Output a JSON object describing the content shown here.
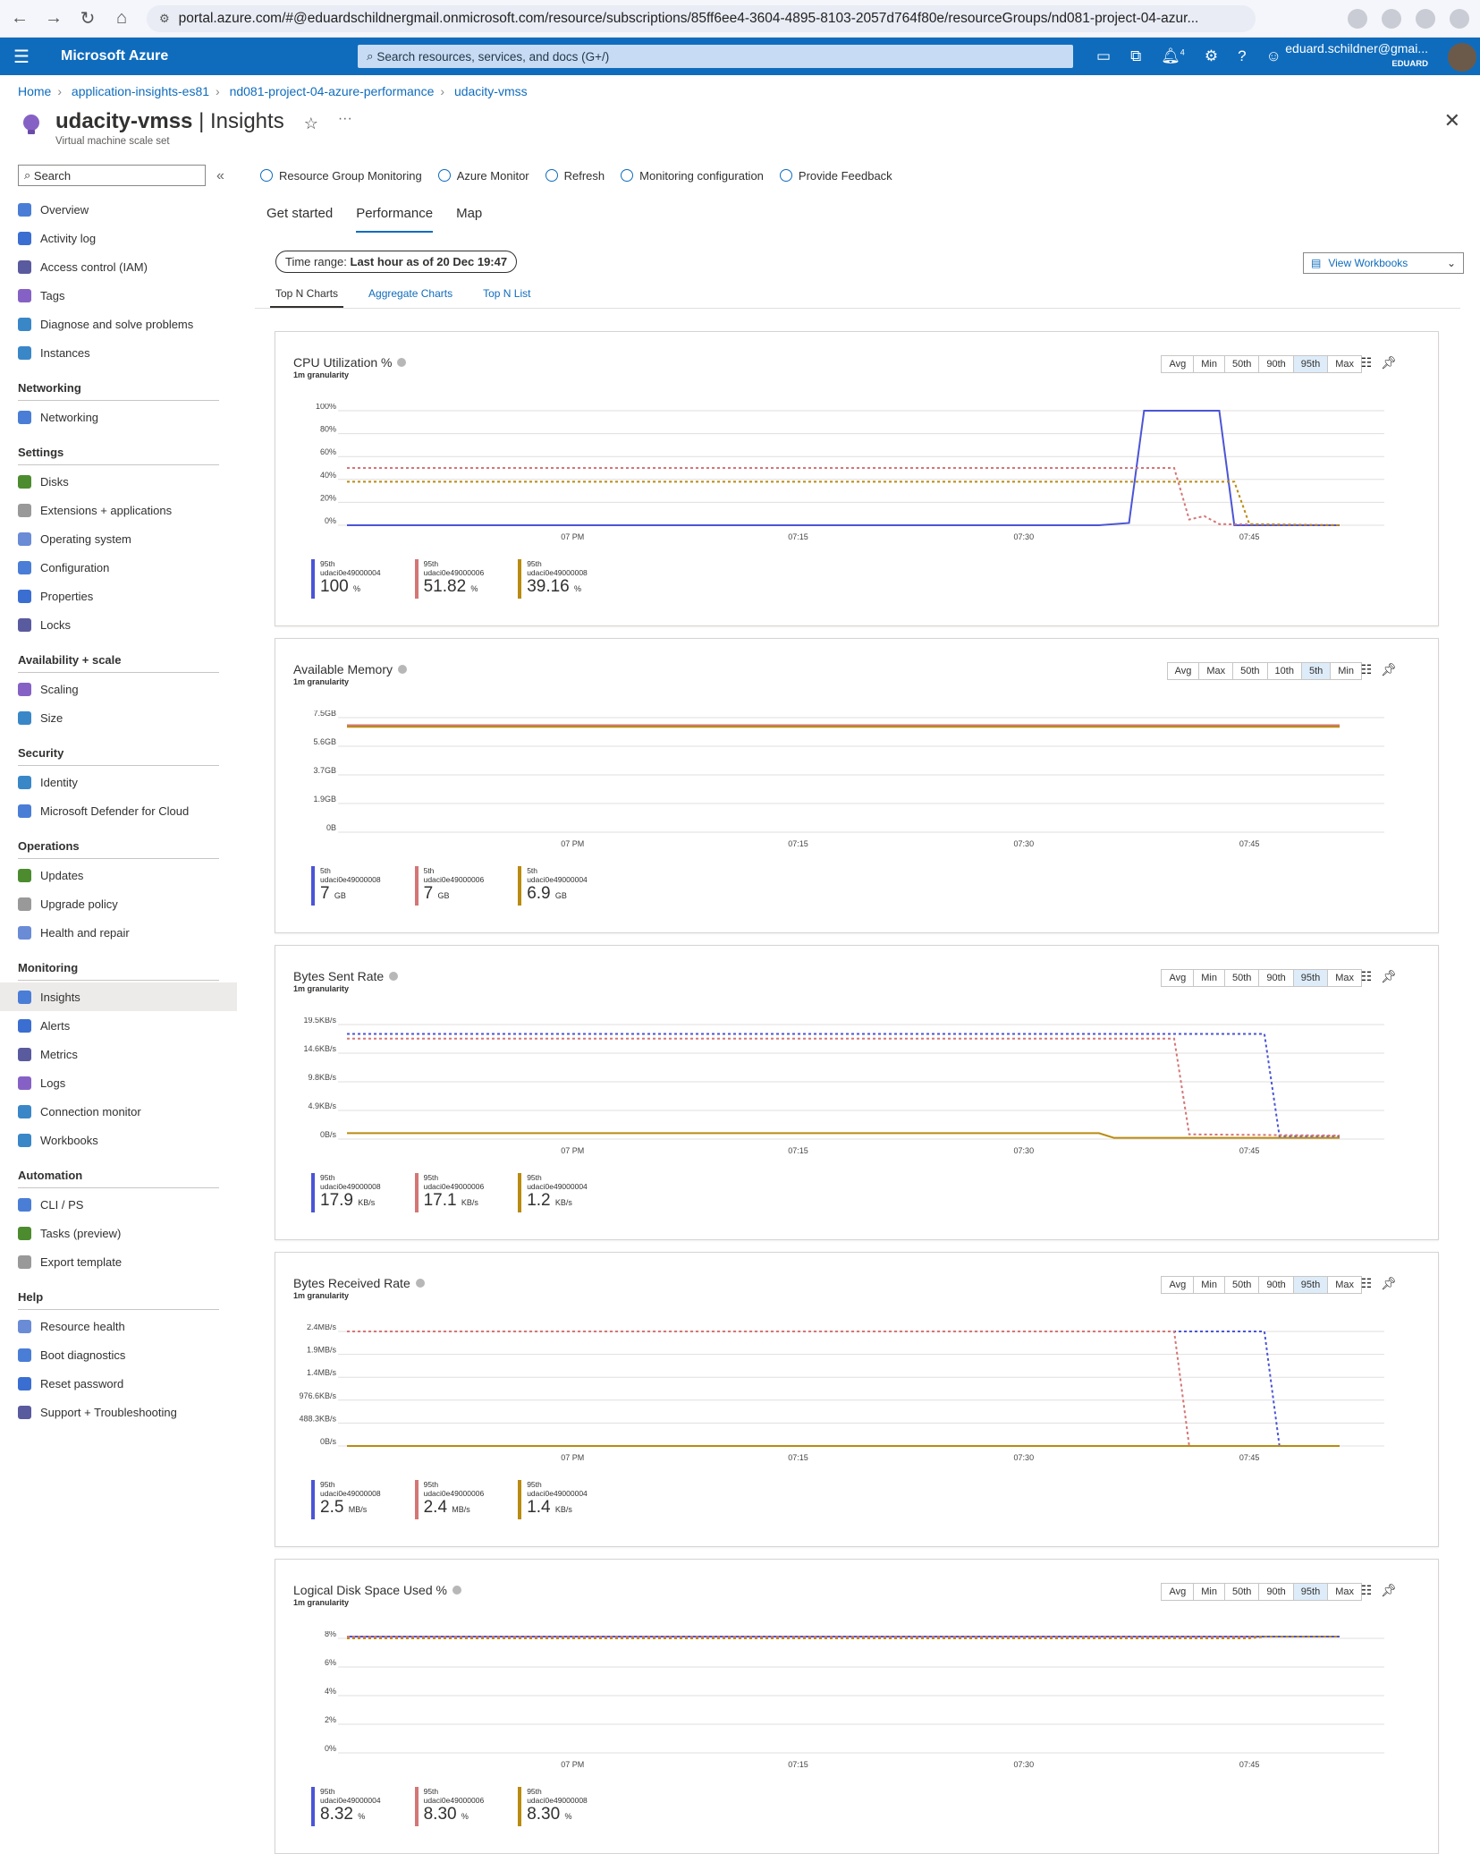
{
  "browser": {
    "url": "portal.azure.com/#@eduardschildnergmail.onmicrosoft.com/resource/subscriptions/85ff6ee4-3604-4895-8103-2057d764f80e/resourceGroups/nd081-project-04-azur..."
  },
  "topbar": {
    "brand": "Microsoft Azure",
    "search_placeholder": "Search resources, services, and docs (G+/)",
    "notifications": "4",
    "user": "eduard.schildner@gmai...",
    "tenant": "EDUARD"
  },
  "breadcrumb": [
    "Home",
    "application-insights-es81",
    "nd081-project-04-azure-performance",
    "udacity-vmss"
  ],
  "title": {
    "resource": "udacity-vmss",
    "page": "Insights",
    "subtitle": "Virtual machine scale set"
  },
  "sidebar": {
    "search": "Search",
    "top": [
      "Overview",
      "Activity log",
      "Access control (IAM)",
      "Tags",
      "Diagnose and solve problems",
      "Instances"
    ],
    "sections": [
      {
        "title": "Networking",
        "items": [
          "Networking"
        ]
      },
      {
        "title": "Settings",
        "items": [
          "Disks",
          "Extensions + applications",
          "Operating system",
          "Configuration",
          "Properties",
          "Locks"
        ]
      },
      {
        "title": "Availability + scale",
        "items": [
          "Scaling",
          "Size"
        ]
      },
      {
        "title": "Security",
        "items": [
          "Identity",
          "Microsoft Defender for Cloud"
        ]
      },
      {
        "title": "Operations",
        "items": [
          "Updates",
          "Upgrade policy",
          "Health and repair"
        ]
      },
      {
        "title": "Monitoring",
        "items": [
          "Insights",
          "Alerts",
          "Metrics",
          "Logs",
          "Connection monitor",
          "Workbooks"
        ]
      },
      {
        "title": "Automation",
        "items": [
          "CLI / PS",
          "Tasks (preview)",
          "Export template"
        ]
      },
      {
        "title": "Help",
        "items": [
          "Resource health",
          "Boot diagnostics",
          "Reset password",
          "Support + Troubleshooting"
        ]
      }
    ],
    "active": "Insights"
  },
  "commands": [
    "Resource Group Monitoring",
    "Azure Monitor",
    "Refresh",
    "Monitoring configuration",
    "Provide Feedback"
  ],
  "tabs": [
    "Get started",
    "Performance",
    "Map"
  ],
  "active_tab": "Performance",
  "time_range": {
    "label": "Time range:",
    "value": "Last hour as of 20 Dec 19:47"
  },
  "view_workbooks": "View Workbooks",
  "subtabs": [
    "Top N Charts",
    "Aggregate Charts",
    "Top N List"
  ],
  "colors": {
    "blue": "#4b55d6",
    "red": "#d47676",
    "gold": "#b98b10",
    "accent": "#0f6cbd"
  },
  "chart_data": [
    {
      "type": "line",
      "title": "CPU Utilization %",
      "granularity": "1m granularity",
      "aggregations": [
        "Avg",
        "Min",
        "50th",
        "90th",
        "95th",
        "Max"
      ],
      "selected": "95th",
      "yticks": [
        "100%",
        "80%",
        "60%",
        "40%",
        "20%",
        "0%"
      ],
      "ylim": [
        0,
        100
      ],
      "xticks": [
        "07 PM",
        "07:15",
        "07:30",
        "07:45"
      ],
      "series": [
        {
          "color": "#4b55d6",
          "points": [
            [
              0,
              0
            ],
            [
              50,
              0
            ],
            [
              52,
              2
            ],
            [
              53,
              100
            ],
            [
              58,
              100
            ],
            [
              59,
              0
            ],
            [
              66,
              0
            ]
          ],
          "dashed_level": null
        },
        {
          "color": "#d47676",
          "points": [
            [
              0,
              50
            ],
            [
              55,
              50
            ],
            [
              56,
              5
            ],
            [
              57,
              8
            ],
            [
              58,
              1
            ],
            [
              66,
              0
            ]
          ],
          "dashed": true
        },
        {
          "color": "#b98b10",
          "points": [
            [
              0,
              38
            ],
            [
              59,
              38
            ],
            [
              60,
              1
            ],
            [
              66,
              0
            ]
          ],
          "dashed": true
        }
      ],
      "legend": [
        {
          "stat": "95th",
          "name": "udaci0e49000004",
          "value": "100",
          "unit": "%",
          "color": "#4b55d6"
        },
        {
          "stat": "95th",
          "name": "udaci0e49000006",
          "value": "51.82",
          "unit": "%",
          "color": "#d47676"
        },
        {
          "stat": "95th",
          "name": "udaci0e49000008",
          "value": "39.16",
          "unit": "%",
          "color": "#b98b10"
        }
      ]
    },
    {
      "type": "line",
      "title": "Available Memory",
      "granularity": "1m granularity",
      "aggregations": [
        "Avg",
        "Max",
        "50th",
        "10th",
        "5th",
        "Min"
      ],
      "selected": "5th",
      "yticks": [
        "7.5GB",
        "5.6GB",
        "3.7GB",
        "1.9GB",
        "0B"
      ],
      "ylim": [
        0,
        7.5
      ],
      "xticks": [
        "07 PM",
        "07:15",
        "07:30",
        "07:45"
      ],
      "series": [
        {
          "color": "#4b55d6",
          "points": [
            [
              0,
              7
            ],
            [
              66,
              7
            ]
          ]
        },
        {
          "color": "#d47676",
          "points": [
            [
              0,
              7
            ],
            [
              66,
              7
            ]
          ]
        },
        {
          "color": "#b98b10",
          "points": [
            [
              0,
              6.9
            ],
            [
              66,
              6.9
            ]
          ]
        }
      ],
      "legend": [
        {
          "stat": "5th",
          "name": "udaci0e49000008",
          "value": "7",
          "unit": "GB",
          "color": "#4b55d6"
        },
        {
          "stat": "5th",
          "name": "udaci0e49000006",
          "value": "7",
          "unit": "GB",
          "color": "#d47676"
        },
        {
          "stat": "5th",
          "name": "udaci0e49000004",
          "value": "6.9",
          "unit": "GB",
          "color": "#b98b10"
        }
      ]
    },
    {
      "type": "line",
      "title": "Bytes Sent Rate",
      "granularity": "1m granularity",
      "aggregations": [
        "Avg",
        "Min",
        "50th",
        "90th",
        "95th",
        "Max"
      ],
      "selected": "95th",
      "yticks": [
        "19.5KB/s",
        "14.6KB/s",
        "9.8KB/s",
        "4.9KB/s",
        "0B/s"
      ],
      "ylim": [
        0,
        19.5
      ],
      "xticks": [
        "07 PM",
        "07:15",
        "07:30",
        "07:45"
      ],
      "series": [
        {
          "color": "#4b55d6",
          "points": [
            [
              0,
              17.9
            ],
            [
              61,
              17.9
            ],
            [
              62,
              0.5
            ],
            [
              66,
              0.5
            ]
          ],
          "dashed": true
        },
        {
          "color": "#d47676",
          "points": [
            [
              0,
              17.1
            ],
            [
              55,
              17.1
            ],
            [
              56,
              0.8
            ],
            [
              66,
              0.6
            ]
          ],
          "dashed": true
        },
        {
          "color": "#b98b10",
          "points": [
            [
              0,
              1
            ],
            [
              50,
              1
            ],
            [
              51,
              0.2
            ],
            [
              66,
              0.2
            ]
          ]
        }
      ],
      "legend": [
        {
          "stat": "95th",
          "name": "udaci0e49000008",
          "value": "17.9",
          "unit": "KB/s",
          "color": "#4b55d6"
        },
        {
          "stat": "95th",
          "name": "udaci0e49000006",
          "value": "17.1",
          "unit": "KB/s",
          "color": "#d47676"
        },
        {
          "stat": "95th",
          "name": "udaci0e49000004",
          "value": "1.2",
          "unit": "KB/s",
          "color": "#b98b10"
        }
      ]
    },
    {
      "type": "line",
      "title": "Bytes Received Rate",
      "granularity": "1m granularity",
      "aggregations": [
        "Avg",
        "Min",
        "50th",
        "90th",
        "95th",
        "Max"
      ],
      "selected": "95th",
      "yticks": [
        "2.4MB/s",
        "1.9MB/s",
        "1.4MB/s",
        "976.6KB/s",
        "488.3KB/s",
        "0B/s"
      ],
      "ylim": [
        0,
        2.4
      ],
      "xticks": [
        "07 PM",
        "07:15",
        "07:30",
        "07:45"
      ],
      "series": [
        {
          "color": "#4b55d6",
          "points": [
            [
              0,
              2.4
            ],
            [
              61,
              2.4
            ],
            [
              62,
              0
            ],
            [
              66,
              0
            ]
          ],
          "dashed": true
        },
        {
          "color": "#d47676",
          "points": [
            [
              0,
              2.4
            ],
            [
              55,
              2.4
            ],
            [
              56,
              0
            ],
            [
              66,
              0
            ]
          ],
          "dashed": true
        },
        {
          "color": "#b98b10",
          "points": [
            [
              0,
              0
            ],
            [
              66,
              0
            ]
          ]
        }
      ],
      "legend": [
        {
          "stat": "95th",
          "name": "udaci0e49000008",
          "value": "2.5",
          "unit": "MB/s",
          "color": "#4b55d6"
        },
        {
          "stat": "95th",
          "name": "udaci0e49000006",
          "value": "2.4",
          "unit": "MB/s",
          "color": "#d47676"
        },
        {
          "stat": "95th",
          "name": "udaci0e49000004",
          "value": "1.4",
          "unit": "KB/s",
          "color": "#b98b10"
        }
      ]
    },
    {
      "type": "line",
      "title": "Logical Disk Space Used %",
      "granularity": "1m granularity",
      "aggregations": [
        "Avg",
        "Min",
        "50th",
        "90th",
        "95th",
        "Max"
      ],
      "selected": "95th",
      "yticks": [
        "8%",
        "6%",
        "4%",
        "2%",
        "0%"
      ],
      "ylim": [
        0,
        8
      ],
      "xticks": [
        "07 PM",
        "07:15",
        "07:30",
        "07:45"
      ],
      "series": [
        {
          "color": "#4b55d6",
          "points": [
            [
              0,
              8.32
            ],
            [
              66,
              8.32
            ]
          ]
        },
        {
          "color": "#d47676",
          "points": [
            [
              0,
              8.3
            ],
            [
              66,
              8.3
            ]
          ],
          "dashed": true
        },
        {
          "color": "#b98b10",
          "points": [
            [
              0,
              8
            ],
            [
              60,
              8
            ],
            [
              61,
              8.3
            ],
            [
              66,
              8.3
            ]
          ],
          "dashed": true
        }
      ],
      "legend": [
        {
          "stat": "95th",
          "name": "udaci0e49000004",
          "value": "8.32",
          "unit": "%",
          "color": "#4b55d6"
        },
        {
          "stat": "95th",
          "name": "udaci0e49000006",
          "value": "8.30",
          "unit": "%",
          "color": "#d47676"
        },
        {
          "stat": "95th",
          "name": "udaci0e49000008",
          "value": "8.30",
          "unit": "%",
          "color": "#b98b10"
        }
      ]
    }
  ]
}
